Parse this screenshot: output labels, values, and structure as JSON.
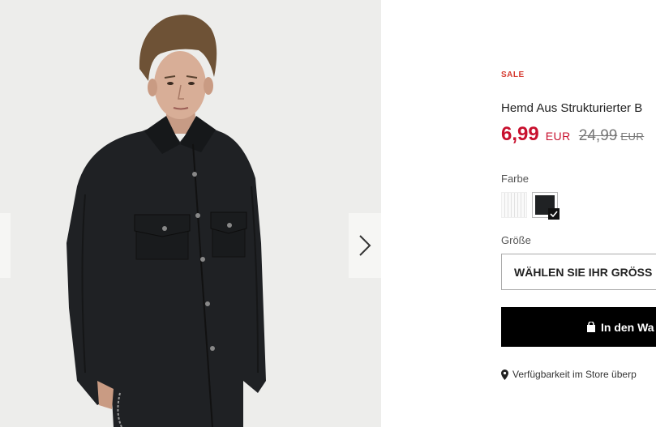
{
  "product": {
    "badge": "SALE",
    "title": "Hemd Aus Strukturierter B",
    "price_now": "6,99",
    "currency_now": "EUR",
    "price_old": "24,99",
    "currency_old": "EUR"
  },
  "color": {
    "label": "Farbe",
    "options": [
      "white-striped",
      "black"
    ],
    "selected": "black"
  },
  "size": {
    "label": "Größe",
    "placeholder": "WÄHLEN SIE IHR GRÖSS"
  },
  "cart": {
    "label": "In den Wa",
    "icon": "shopping-bag-icon"
  },
  "store": {
    "label": "Verfügbarkeit im Store überp",
    "icon": "map-pin-icon"
  },
  "gallery": {
    "next_icon": "chevron-right-icon",
    "prev_icon": "chevron-left-icon"
  }
}
